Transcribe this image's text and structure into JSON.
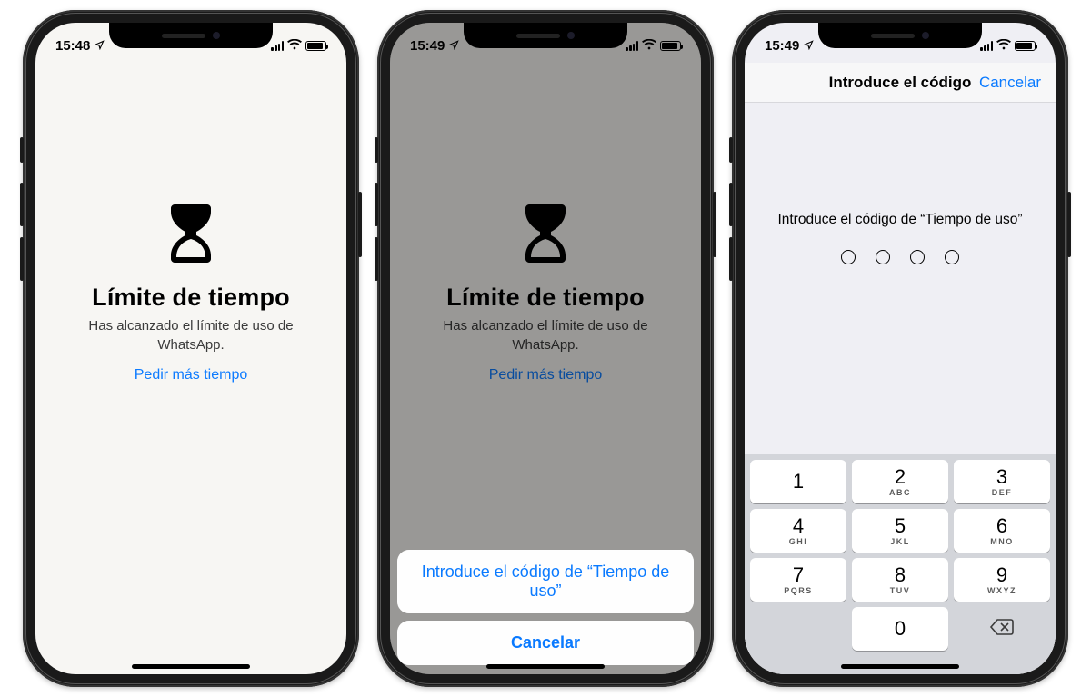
{
  "colors": {
    "link": "#0d7bff"
  },
  "statusbar": {
    "time1": "15:48",
    "time2": "15:49",
    "time3": "15:49"
  },
  "limit": {
    "title": "Límite de tiempo",
    "subtitle": "Has alcanzado el límite de uso de WhatsApp.",
    "link": "Pedir más tiempo"
  },
  "sheet": {
    "option": "Introduce el código de “Tiempo de uso”",
    "cancel": "Cancelar"
  },
  "passcode": {
    "nav_title": "Introduce el código",
    "nav_cancel": "Cancelar",
    "prompt": "Introduce el código de “Tiempo de uso”"
  },
  "keypad": {
    "keys": [
      {
        "d": "1",
        "l": ""
      },
      {
        "d": "2",
        "l": "ABC"
      },
      {
        "d": "3",
        "l": "DEF"
      },
      {
        "d": "4",
        "l": "GHI"
      },
      {
        "d": "5",
        "l": "JKL"
      },
      {
        "d": "6",
        "l": "MNO"
      },
      {
        "d": "7",
        "l": "PQRS"
      },
      {
        "d": "8",
        "l": "TUV"
      },
      {
        "d": "9",
        "l": "WXYZ"
      }
    ],
    "zero": {
      "d": "0",
      "l": ""
    }
  }
}
